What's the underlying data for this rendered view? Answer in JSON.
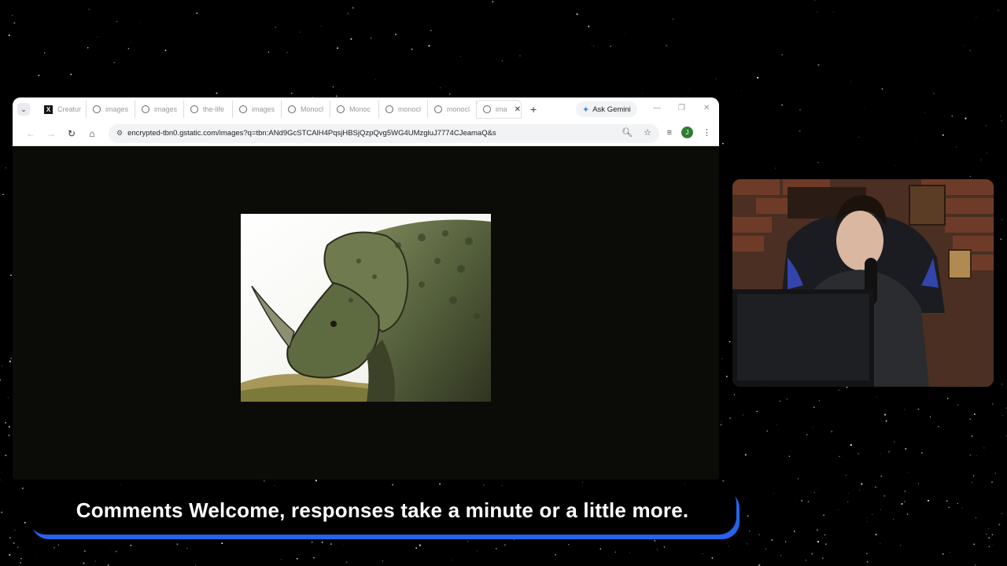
{
  "browser": {
    "tabs": [
      {
        "label": "Creatur",
        "icon": "x-logo-icon"
      },
      {
        "label": "images",
        "icon": "globe-icon"
      },
      {
        "label": "images",
        "icon": "globe-icon"
      },
      {
        "label": "the-life",
        "icon": "globe-icon"
      },
      {
        "label": "images",
        "icon": "globe-icon"
      },
      {
        "label": "Monocl",
        "icon": "globe-icon"
      },
      {
        "label": "Monoc",
        "icon": "globe-icon"
      },
      {
        "label": "monocl",
        "icon": "globe-icon"
      },
      {
        "label": "monocl",
        "icon": "globe-icon"
      },
      {
        "label": "ima",
        "icon": "globe-icon",
        "active": true
      }
    ],
    "ask_gemini_label": "Ask Gemini",
    "url": "encrypted-tbn0.gstatic.com/images?q=tbn:ANd9GcSTCAlH4PqsjHBSjQzpQvg5WG4UMzgluJ7774CJeamaQ&s",
    "profile_initial": "J"
  },
  "caption": {
    "text": "Comments Welcome, responses take a minute or a little more."
  },
  "colors": {
    "caption_accent": "#2563eb",
    "page_bg": "#000000",
    "browser_viewport": "#0b0b08"
  }
}
